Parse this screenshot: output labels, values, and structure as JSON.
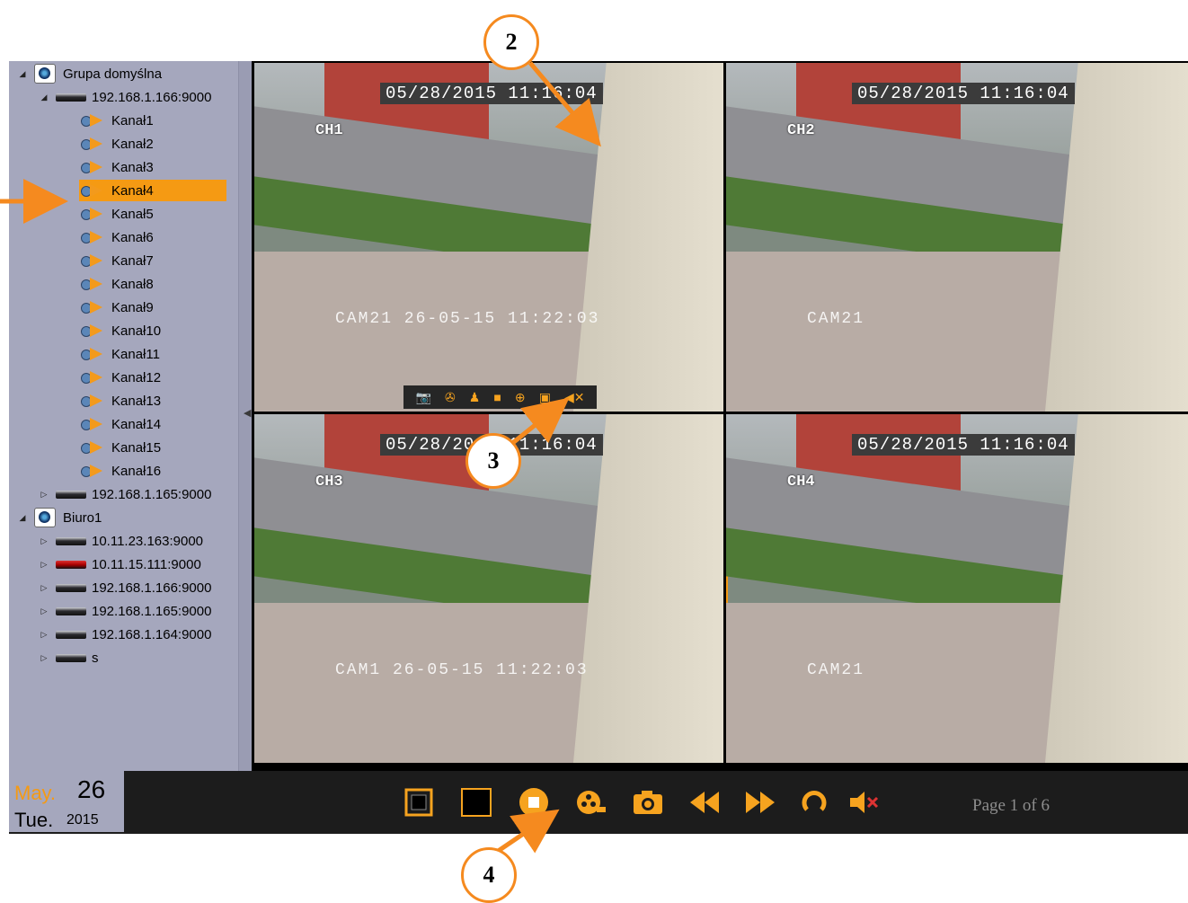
{
  "sidebar": {
    "groups": [
      {
        "label": "Grupa domyślna",
        "devices": [
          {
            "label": "192.168.1.166:9000",
            "channels": [
              "Kanał1",
              "Kanał2",
              "Kanał3",
              "Kanał4",
              "Kanał5",
              "Kanał6",
              "Kanał7",
              "Kanał8",
              "Kanał9",
              "Kanał10",
              "Kanał11",
              "Kanał12",
              "Kanał13",
              "Kanał14",
              "Kanał15",
              "Kanał16"
            ],
            "selected_channel": "Kanał4"
          },
          {
            "label": "192.168.1.165:9000"
          }
        ]
      },
      {
        "label": "Biuro1",
        "devices": [
          {
            "label": "10.11.23.163:9000"
          },
          {
            "label": "10.11.15.111:9000"
          },
          {
            "label": "192.168.1.166:9000"
          },
          {
            "label": "192.168.1.165:9000"
          },
          {
            "label": "192.168.1.164:9000"
          },
          {
            "label": "s"
          }
        ]
      }
    ]
  },
  "videos": [
    {
      "timestamp": "05/28/2015 11:16:04",
      "channel": "CH1",
      "overlay": "CAM21 26-05-15 11:22:03",
      "active": false
    },
    {
      "timestamp": "05/28/2015 11:16:04",
      "channel": "CH2",
      "overlay": "CAM21",
      "active": false
    },
    {
      "timestamp": "05/28/2015 11:16:04",
      "channel": "CH3",
      "overlay": "CAM1 26-05-15 11:22:03",
      "active": false
    },
    {
      "timestamp": "05/28/2015 11:16:04",
      "channel": "CH4",
      "overlay": "CAM21",
      "active": true
    }
  ],
  "minibar_icons": [
    "camera-icon",
    "record-icon",
    "person-icon",
    "stop-icon",
    "zoom-icon",
    "lock-icon",
    "mute-icon"
  ],
  "date": {
    "month": "May.",
    "day": "26",
    "weekday": "Tue.",
    "year": "2015"
  },
  "controls": [
    "fullscreen-icon",
    "single-view-icon",
    "stop-icon",
    "record-icon",
    "snapshot-icon",
    "rewind-icon",
    "fast-forward-icon",
    "refresh-icon",
    "mute-icon"
  ],
  "page_info": "Page 1 of 6",
  "callouts": [
    "2",
    "3",
    "4"
  ],
  "colors": {
    "accent": "#f59a13",
    "sidebar": "#a5a7bd",
    "toolbar": "#1c1c1c"
  }
}
